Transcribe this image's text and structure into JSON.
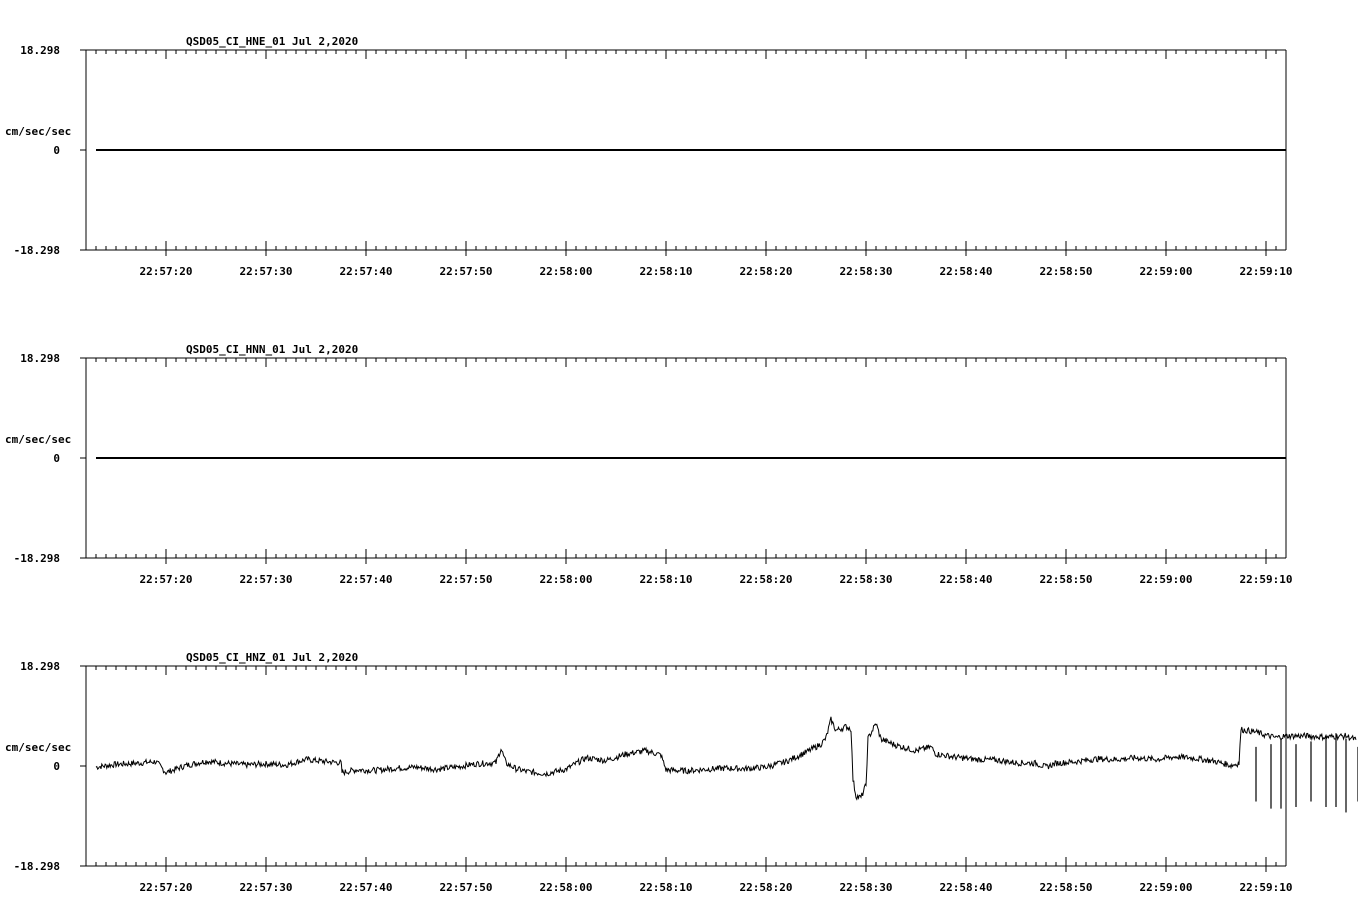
{
  "chart_data": [
    {
      "type": "line",
      "title": "QSD05_CI_HNE_01  Jul 2,2020",
      "ylabel": "cm/sec/sec",
      "ylim": [
        -18.298,
        18.298
      ],
      "y_ticks": [
        "18.298",
        "0",
        "-18.298"
      ],
      "x_ticks": [
        "22:57:20",
        "22:57:30",
        "22:57:40",
        "22:57:50",
        "22:58:00",
        "22:58:10",
        "22:58:20",
        "22:58:30",
        "22:58:40",
        "22:58:50",
        "22:59:00",
        "22:59:10"
      ],
      "x_range_seconds": [
        -8,
        112
      ],
      "series": [
        {
          "kind": "flat",
          "start": -7,
          "end": 112,
          "value": 0
        }
      ]
    },
    {
      "type": "line",
      "title": "QSD05_CI_HNN_01  Jul 2,2020",
      "ylabel": "cm/sec/sec",
      "ylim": [
        -18.298,
        18.298
      ],
      "y_ticks": [
        "18.298",
        "0",
        "-18.298"
      ],
      "x_ticks": [
        "22:57:20",
        "22:57:30",
        "22:57:40",
        "22:57:50",
        "22:58:00",
        "22:58:10",
        "22:58:20",
        "22:58:30",
        "22:58:40",
        "22:58:50",
        "22:59:00",
        "22:59:10"
      ],
      "x_range_seconds": [
        -8,
        112
      ],
      "series": [
        {
          "kind": "flat",
          "start": -7,
          "end": 112,
          "value": 0
        }
      ]
    },
    {
      "type": "line",
      "title": "QSD05_CI_HNZ_01  Jul 2,2020",
      "ylabel": "cm/sec/sec",
      "ylim": [
        -18.298,
        18.298
      ],
      "y_ticks": [
        "18.298",
        "0",
        "-18.298"
      ],
      "x_ticks": [
        "22:57:20",
        "22:57:30",
        "22:57:40",
        "22:57:50",
        "22:58:00",
        "22:58:10",
        "22:58:20",
        "22:58:30",
        "22:58:40",
        "22:58:50",
        "22:59:00",
        "22:59:10"
      ],
      "x_range_seconds": [
        -8,
        112
      ],
      "series": [
        {
          "kind": "trace",
          "points": [
            [
              -7,
              -0.2
            ],
            [
              -5,
              0.3
            ],
            [
              -3,
              0.5
            ],
            [
              -1,
              0.8
            ],
            [
              0,
              -1.2
            ],
            [
              2,
              0.1
            ],
            [
              4,
              0.9
            ],
            [
              6,
              0.5
            ],
            [
              8,
              0.2
            ],
            [
              10,
              0.4
            ],
            [
              12,
              0.2
            ],
            [
              14,
              1.2
            ],
            [
              16,
              0.8
            ],
            [
              17.5,
              0.6
            ],
            [
              17.6,
              -1.2
            ],
            [
              19,
              -0.7
            ],
            [
              21,
              -0.8
            ],
            [
              23,
              -0.4
            ],
            [
              25,
              -0.2
            ],
            [
              27,
              -0.6
            ],
            [
              29,
              -0.2
            ],
            [
              31,
              0.4
            ],
            [
              33,
              0.6
            ],
            [
              33.5,
              3.2
            ],
            [
              34,
              0.5
            ],
            [
              35,
              -0.5
            ],
            [
              36,
              -1.0
            ],
            [
              38,
              -1.4
            ],
            [
              40,
              -0.6
            ],
            [
              42,
              1.5
            ],
            [
              44,
              1.0
            ],
            [
              46,
              2.2
            ],
            [
              48,
              2.8
            ],
            [
              49.5,
              2.0
            ],
            [
              50,
              -0.7
            ],
            [
              52,
              -0.9
            ],
            [
              54,
              -0.6
            ],
            [
              56,
              -0.4
            ],
            [
              58,
              -0.5
            ],
            [
              60,
              -0.2
            ],
            [
              62,
              0.8
            ],
            [
              64,
              2.5
            ],
            [
              65.5,
              4.0
            ],
            [
              66,
              5.1
            ],
            [
              66.5,
              8.5
            ],
            [
              67,
              6.5
            ],
            [
              68,
              7.2
            ],
            [
              68.5,
              6.8
            ],
            [
              68.7,
              -2.5
            ],
            [
              69,
              -5.5
            ],
            [
              69.5,
              -5.8
            ],
            [
              70,
              -3.5
            ],
            [
              70.2,
              5.0
            ],
            [
              71,
              7.8
            ],
            [
              71.5,
              4.9
            ],
            [
              73,
              3.8
            ],
            [
              75,
              2.8
            ],
            [
              76.5,
              3.5
            ],
            [
              77,
              2.2
            ],
            [
              79,
              1.6
            ],
            [
              81,
              1.2
            ],
            [
              83,
              1.1
            ],
            [
              85,
              0.6
            ],
            [
              87,
              0.5
            ],
            [
              88,
              -0.2
            ],
            [
              89,
              0.5
            ],
            [
              91,
              0.8
            ],
            [
              93,
              1.3
            ],
            [
              95,
              1.2
            ],
            [
              97,
              1.5
            ],
            [
              99,
              1.2
            ],
            [
              101,
              1.7
            ],
            [
              103,
              1.4
            ],
            [
              105,
              0.8
            ],
            [
              106.5,
              0.1
            ],
            [
              107.3,
              0.5
            ],
            [
              107.5,
              6.7
            ],
            [
              109,
              6.2
            ],
            [
              110,
              5.6
            ],
            [
              111,
              5.2
            ],
            [
              112,
              5.5
            ],
            [
              114,
              5.5
            ],
            [
              116,
              5.3
            ],
            [
              118,
              5.5
            ],
            [
              119,
              4.8
            ]
          ],
          "spikes": [
            [
              109,
              3.5,
              -6.5
            ],
            [
              110.5,
              4.0,
              -7.8
            ],
            [
              111.5,
              5.0,
              -7.8
            ],
            [
              113,
              4.0,
              -7.5
            ],
            [
              114.5,
              4.5,
              -6.5
            ],
            [
              116,
              5.5,
              -7.5
            ],
            [
              117,
              6.0,
              -7.5
            ],
            [
              118,
              5.0,
              -8.5
            ],
            [
              119.2,
              3.5,
              -6.5
            ]
          ]
        }
      ]
    }
  ]
}
